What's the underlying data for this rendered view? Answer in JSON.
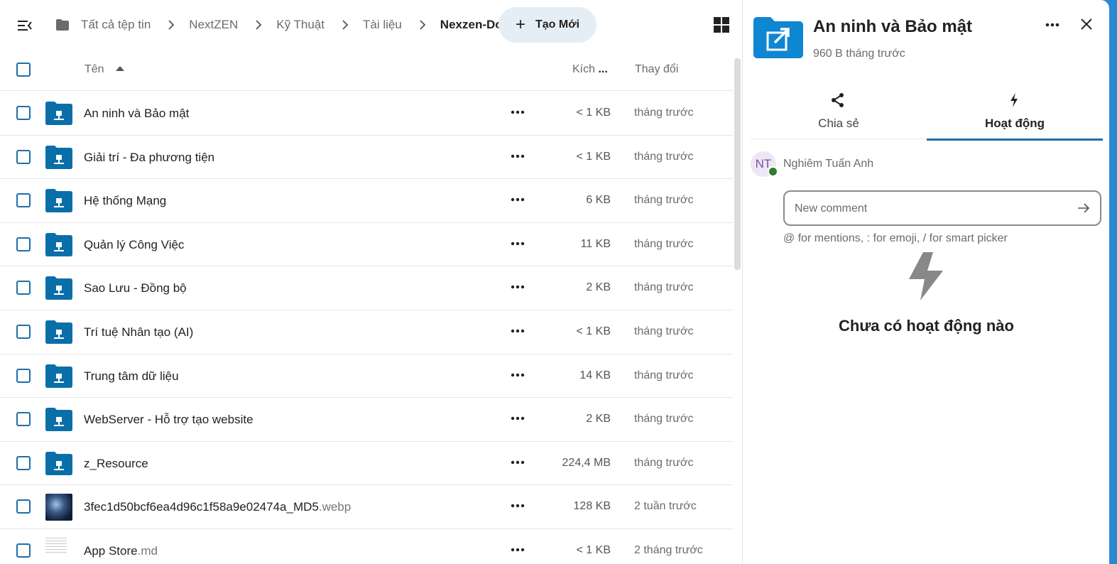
{
  "breadcrumb": {
    "items": [
      "Tất cả tệp tin",
      "NextZEN",
      "Kỹ Thuật",
      "Tài liệu"
    ],
    "current": "Nexzen-Doc"
  },
  "toolbar": {
    "new_label": "Tạo Mới"
  },
  "table": {
    "col_name": "Tên",
    "col_size": "Kích",
    "col_size_more": "...",
    "col_modified": "Thay đổi",
    "rows": [
      {
        "name": "An ninh và Bảo mật",
        "ext": "",
        "size": "< 1 KB",
        "modified": "tháng trước",
        "kind": "folder"
      },
      {
        "name": "Giải trí - Đa phương tiện",
        "ext": "",
        "size": "< 1 KB",
        "modified": "tháng trước",
        "kind": "folder"
      },
      {
        "name": "Hệ thống Mạng",
        "ext": "",
        "size": "6 KB",
        "modified": "tháng trước",
        "kind": "folder"
      },
      {
        "name": "Quản lý Công Việc",
        "ext": "",
        "size": "11 KB",
        "modified": "tháng trước",
        "kind": "folder"
      },
      {
        "name": "Sao Lưu - Đồng bộ",
        "ext": "",
        "size": "2 KB",
        "modified": "tháng trước",
        "kind": "folder"
      },
      {
        "name": "Trí tuệ Nhân tạo (AI)",
        "ext": "",
        "size": "< 1 KB",
        "modified": "tháng trước",
        "kind": "folder"
      },
      {
        "name": "Trung tâm dữ liệu",
        "ext": "",
        "size": "14 KB",
        "modified": "tháng trước",
        "kind": "folder"
      },
      {
        "name": "WebServer - Hỗ trợ tạo website",
        "ext": "",
        "size": "2 KB",
        "modified": "tháng trước",
        "kind": "folder"
      },
      {
        "name": "z_Resource",
        "ext": "",
        "size": "224,4 MB",
        "modified": "tháng trước",
        "kind": "folder"
      },
      {
        "name": "3fec1d50bcf6ea4d96c1f58a9e02474a_MD5",
        "ext": ".webp",
        "size": "128 KB",
        "modified": "2 tuần trước",
        "kind": "image"
      },
      {
        "name": "App Store",
        "ext": ".md",
        "size": "< 1 KB",
        "modified": "2 tháng trước",
        "kind": "doc"
      }
    ]
  },
  "sidebar": {
    "title": "An ninh và Bảo mật",
    "subtitle": "960 B tháng trước",
    "tabs": {
      "share": "Chia sẻ",
      "activity": "Hoạt động"
    },
    "comment": {
      "user_initials": "NT",
      "user_name": "Nghiêm Tuấn Anh",
      "placeholder": "New comment",
      "hint": "@ for mentions, : for emoji, / for smart picker"
    },
    "empty_title": "Chưa có hoạt động nào"
  },
  "colors": {
    "accent": "#1f6fa6",
    "folder": "#0a6fa8",
    "sidebar_folder": "#0f86d2",
    "online": "#2e7d32"
  }
}
